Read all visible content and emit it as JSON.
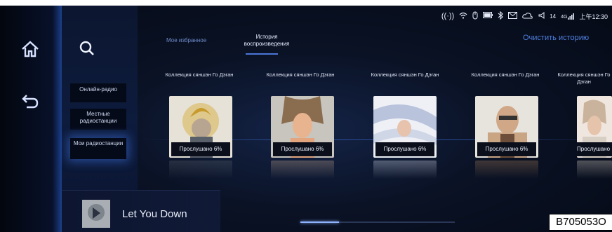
{
  "statusbar": {
    "signal_radio_icon": "((·))",
    "wifi_icon": "wifi",
    "mouse_icon": "mouse",
    "battery_icon": "battery",
    "bluetooth_icon": "bluetooth",
    "mail_icon": "mail",
    "weather_icon": "cloud-sun",
    "volume_level": "14",
    "network": "4G",
    "time": "上午12:30"
  },
  "sidebar": {
    "items": [
      {
        "icon": "home-icon"
      },
      {
        "icon": "back-icon"
      }
    ]
  },
  "categories": [
    {
      "label": "Онлайн-радио",
      "active": false
    },
    {
      "label": "Местные радиостанции",
      "active": false
    },
    {
      "label": "Мои радиостанции",
      "active": true
    }
  ],
  "tabs": [
    {
      "label": "Мое избранное",
      "active": false
    },
    {
      "label": "История воспроизведения",
      "active": true
    }
  ],
  "clear_history": "Очистить историю",
  "cards": [
    {
      "title": "Коллекция сяншэн Го Дэган",
      "progress": "Прослушано 6%",
      "colors": [
        "#d9cba8",
        "#59606a"
      ]
    },
    {
      "title": "Коллекция сяншэн Го Дэган",
      "progress": "Прослушано 6%",
      "colors": [
        "#bfbcb6",
        "#e3a57d"
      ]
    },
    {
      "title": "Коллекция сяншэн Го Дэган",
      "progress": "Прослушано 6%",
      "colors": [
        "#cfd6e6",
        "#f3f5fb"
      ]
    },
    {
      "title": "Коллекция сяншэн Го Дэган",
      "progress": "Прослушано 6%",
      "colors": [
        "#c9a583",
        "#6d4e3a"
      ]
    },
    {
      "title": "Коллекция сяншэн Го Дэган",
      "progress": "Прослушано",
      "colors": [
        "#d8cfc4",
        "#efe7df"
      ]
    }
  ],
  "now_playing": {
    "title": "Let You Down",
    "progress_fraction": 0.25
  },
  "figure_code": "B705053O"
}
